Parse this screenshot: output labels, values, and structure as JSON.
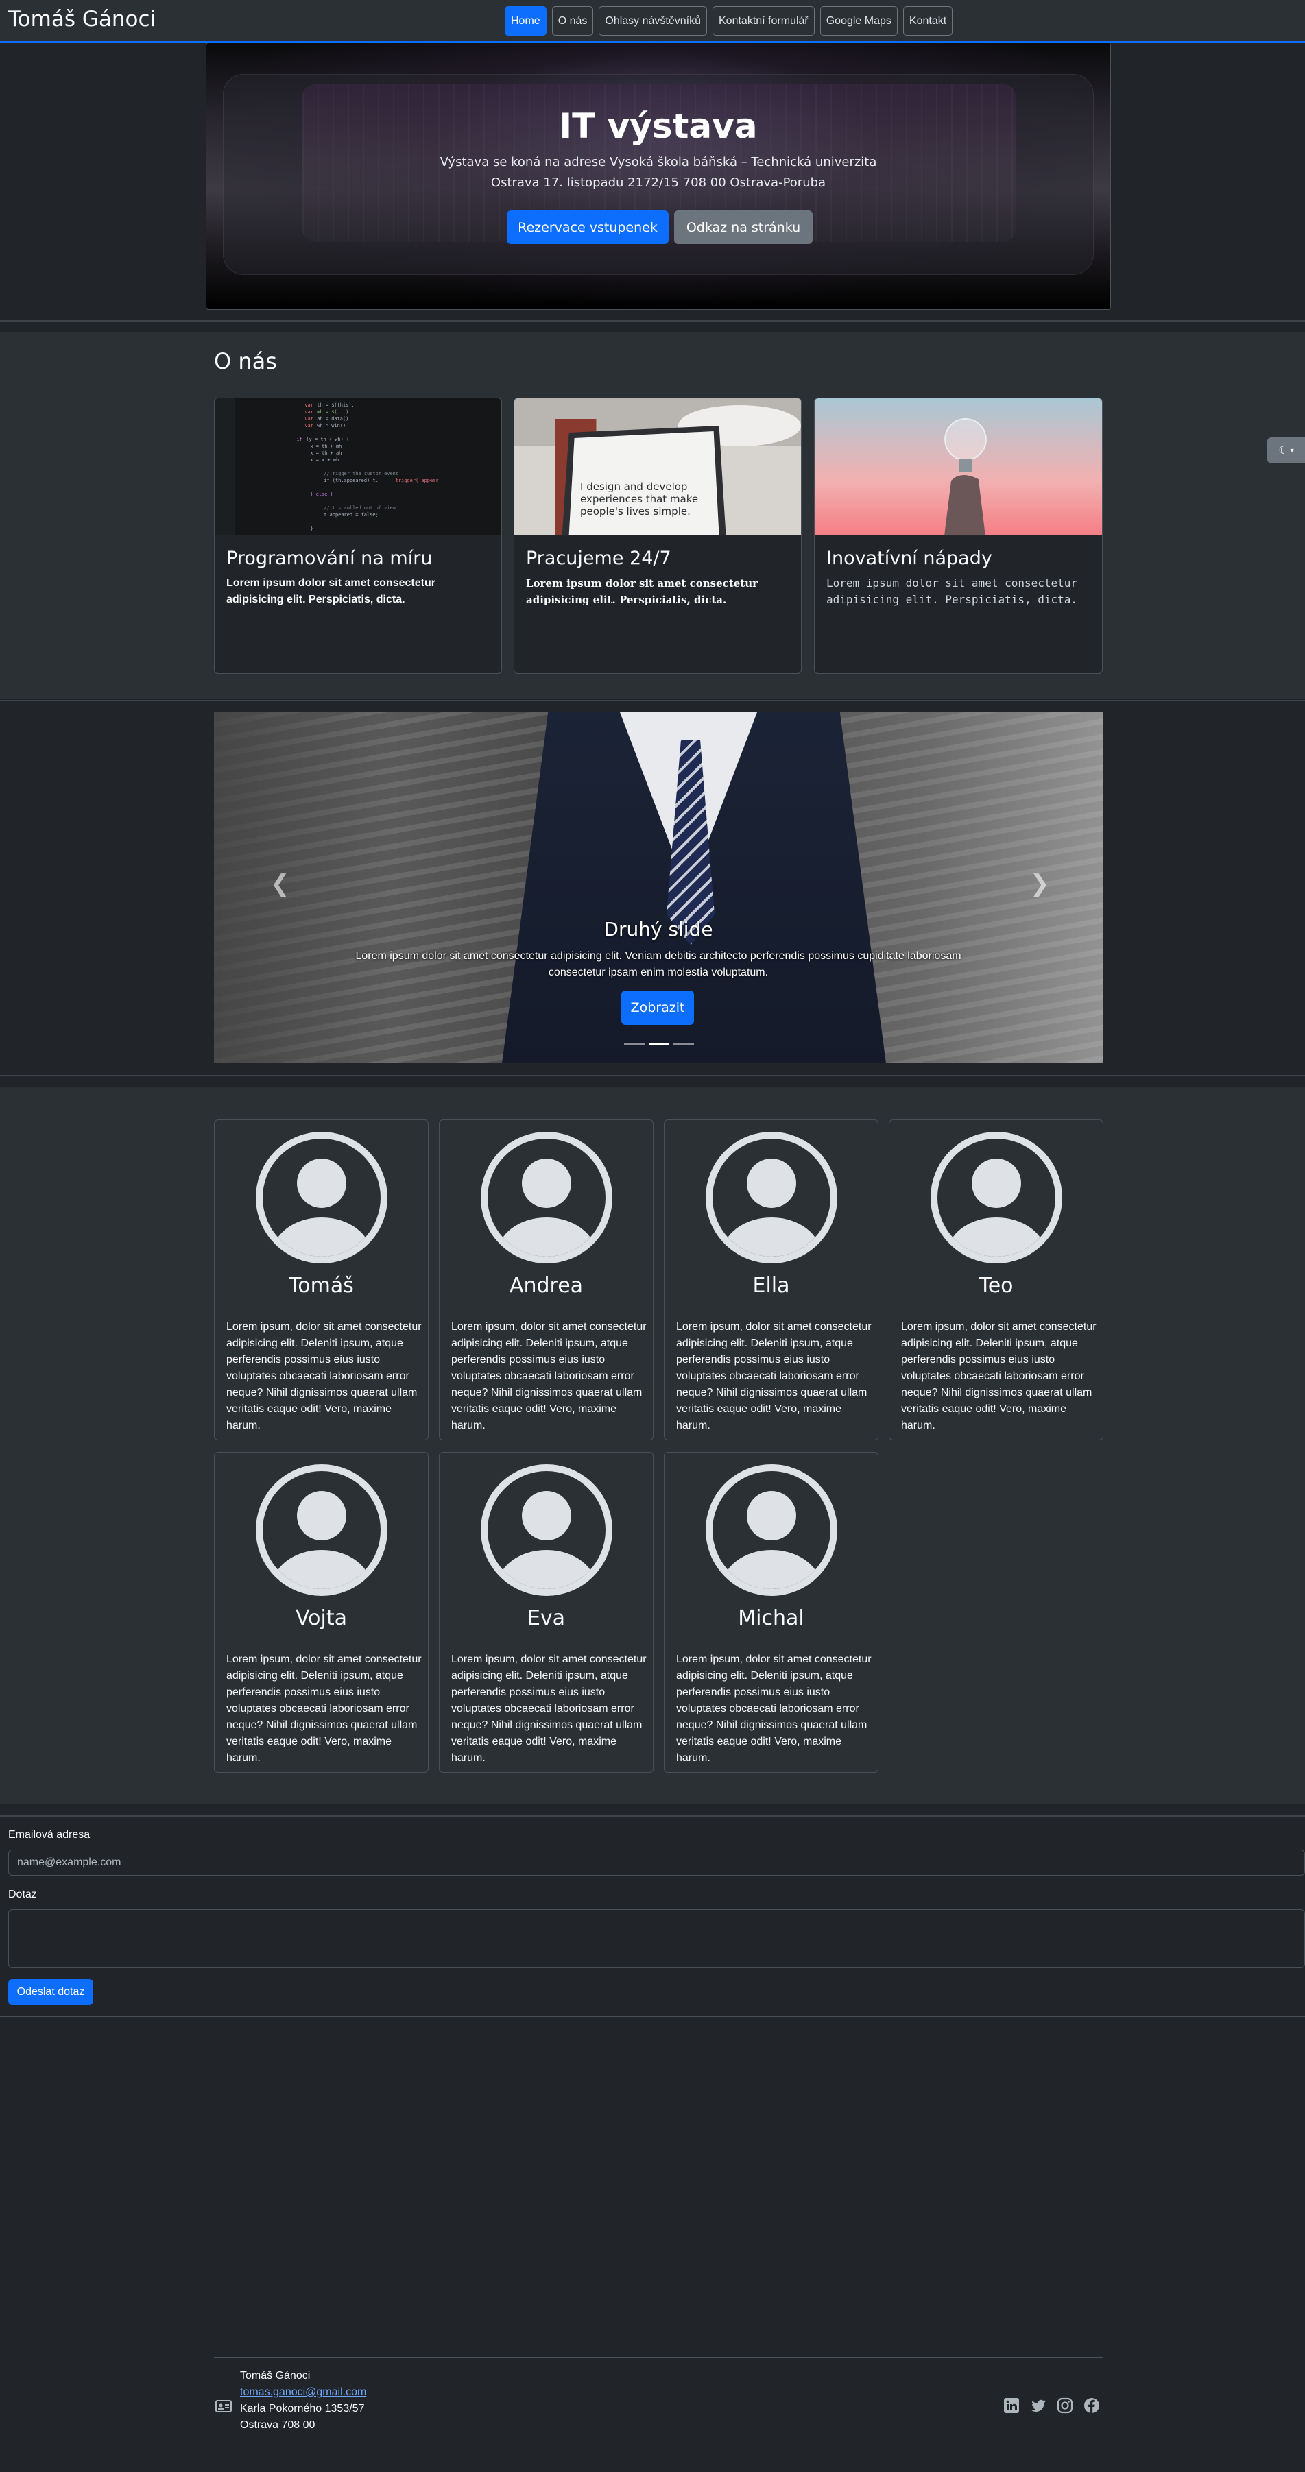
{
  "brand": "Tomáš Gánoci",
  "nav": {
    "items": [
      "Home",
      "O nás",
      "Ohlasy návštěvníků",
      "Kontaktní formulář",
      "Google Maps",
      "Kontakt"
    ],
    "active": "Home"
  },
  "hero": {
    "title": "IT výstava",
    "line1": "Výstava se koná na adrese Vysoká škola báňská – Technická univerzita",
    "line2": "Ostrava 17. listopadu 2172/15 708 00 Ostrava-Poruba",
    "button_primary": "Rezervace vstupenek",
    "button_secondary": "Odkaz na stránku"
  },
  "about": {
    "title": "O nás",
    "cards": [
      {
        "title": "Programování na míru",
        "text": "Lorem ipsum dolor sit amet consectetur adipisicing elit. Perspiciatis, dicta."
      },
      {
        "title": "Pracujeme 24/7",
        "text": "Lorem ipsum dolor sit amet consectetur adipisicing elit. Perspiciatis, dicta.",
        "image_text": "I design and develop experiences that make people's lives simple."
      },
      {
        "title": "Inovatívní nápady",
        "text": "Lorem ipsum dolor sit amet consectetur adipisicing elit. Perspiciatis, dicta."
      }
    ]
  },
  "carousel": {
    "title": "Druhý slide",
    "text": "Lorem ipsum dolor sit amet consectetur adipisicing elit. Veniam debitis architecto perferendis possimus cupiditate laboriosam consectetur ipsam enim molestia voluptatum.",
    "button": "Zobrazit",
    "prev_icon": "chevron-left-icon",
    "next_icon": "chevron-right-icon"
  },
  "team": {
    "text": "Lorem ipsum, dolor sit amet consectetur adipisicing elit. Deleniti ipsum, atque perferendis possimus eius iusto voluptates obcaecati laboriosam error neque? Nihil dignissimos quaerat ullam veritatis eaque odit! Vero, maxime harum.",
    "members": [
      "Tomáš",
      "Andrea",
      "Ella",
      "Teo",
      "Vojta",
      "Eva",
      "Michal"
    ]
  },
  "form": {
    "email_label": "Emailová adresa",
    "email_placeholder": "name@example.com",
    "question_label": "Dotaz",
    "submit": "Odeslat dotaz"
  },
  "footer": {
    "name": "Tomáš Gánoci",
    "email": "tomas.ganoci@gmail.com",
    "street": "Karla Pokorného 1353/57",
    "city": "Ostrava 708 00",
    "social": [
      "linkedin-icon",
      "twitter-icon",
      "instagram-icon",
      "facebook-icon"
    ]
  },
  "colors": {
    "primary": "#0d6efd",
    "secondary": "#6c757d",
    "background": "#212529",
    "surface": "#2b3035"
  }
}
